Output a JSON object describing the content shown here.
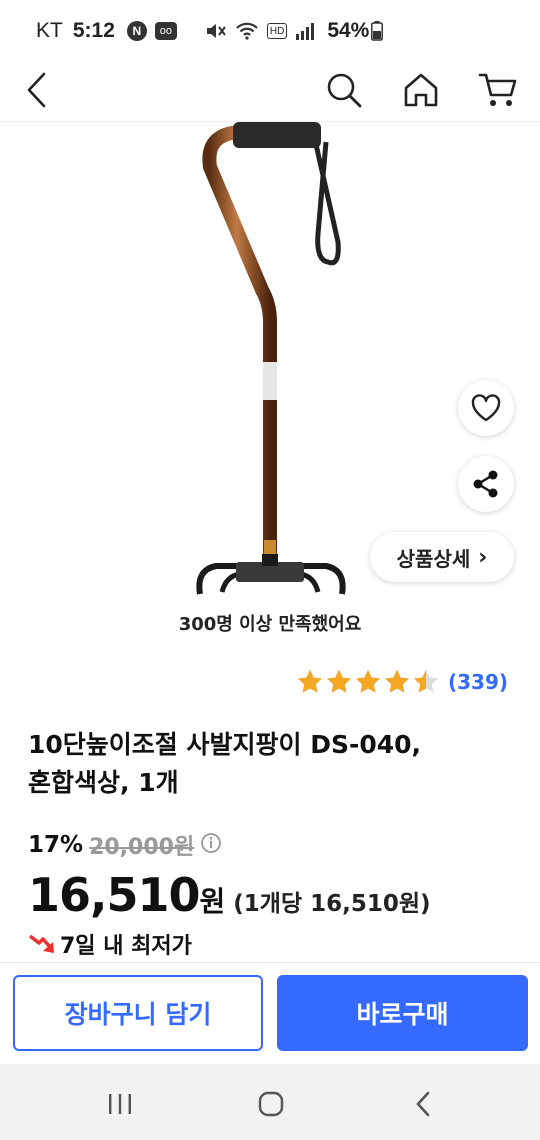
{
  "status_bar": {
    "carrier": "KT",
    "time": "5:12",
    "notif_badge": "N",
    "voicemail_badge": "oo",
    "hd_badge": "HD",
    "battery": "54%"
  },
  "header": {
    "icons": [
      "back-icon",
      "search-icon",
      "home-icon",
      "cart-icon"
    ]
  },
  "image_overlay": {
    "detail_button_label": "상품상세",
    "detail_button_chevron": "›"
  },
  "satisfaction_text": "300명 이상 만족했어요",
  "rating": {
    "stars": 4.5,
    "review_count": "(339)"
  },
  "product": {
    "title_line1": "10단높이조절 사발지팡이 DS-040,",
    "title_line2": "혼합색상, 1개"
  },
  "price": {
    "discount": "17%",
    "original": "20,000원",
    "sale": "16,510",
    "sale_unit": "원",
    "unit_price": "(1개당 16,510원)",
    "lowest_label": "7일 내 최저가"
  },
  "actions": {
    "cart_label": "장바구니 담기",
    "buy_label": "바로구매"
  },
  "colors": {
    "accent": "#346aff",
    "star": "#f5a623",
    "lowest_icon": "#e8312f"
  }
}
